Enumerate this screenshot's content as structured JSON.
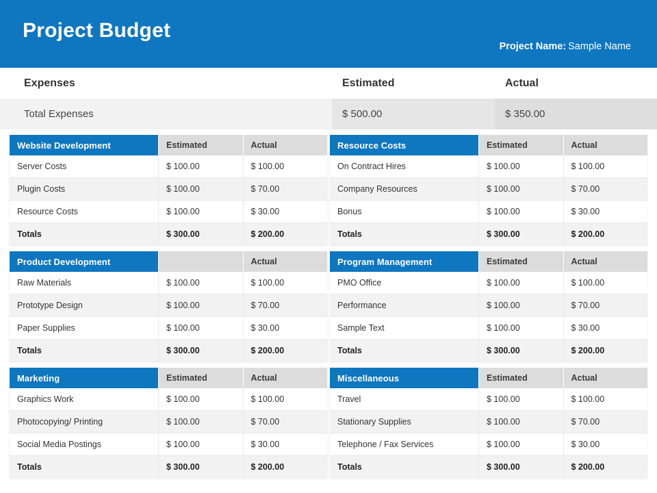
{
  "banner": {
    "title": "Project Budget",
    "project_name_label": "Project Name:",
    "project_name_value": "Sample Name",
    "background_color": "#0f76c0"
  },
  "summary": {
    "headers": {
      "expenses": "Expenses",
      "estimated": "Estimated",
      "actual": "Actual"
    },
    "row": {
      "label": "Total Expenses",
      "estimated": "$ 500.00",
      "actual": "$ 350.00"
    }
  },
  "column_headers": {
    "estimated": "Estimated",
    "actual": "Actual"
  },
  "totals_label": "Totals",
  "accent_color": "#0f76c0",
  "header_cell_color": "#dcdcdc",
  "stripe_color": "#f2f2f2",
  "blocks": [
    {
      "title": "Website Development",
      "estimated_header": "Estimated",
      "actual_header": "Actual",
      "rows": [
        {
          "name": "Server Costs",
          "estimated": "$ 100.00",
          "actual": "$ 100.00"
        },
        {
          "name": " Plugin Costs",
          "estimated": "$ 100.00",
          "actual": "$ 70.00"
        },
        {
          "name": "Resource Costs",
          "estimated": "$ 100.00",
          "actual": "$ 30.00"
        }
      ],
      "totals": {
        "name": "Totals",
        "estimated": "$ 300.00",
        "actual": "$ 200.00"
      }
    },
    {
      "title": "Resource Costs",
      "estimated_header": "Estimated",
      "actual_header": "Actual",
      "rows": [
        {
          "name": "On Contract Hires",
          "estimated": "$ 100.00",
          "actual": "$ 100.00"
        },
        {
          "name": " Company  Resources",
          "estimated": "$ 100.00",
          "actual": "$ 70.00"
        },
        {
          "name": "Bonus",
          "estimated": "$ 100.00",
          "actual": "$ 30.00"
        }
      ],
      "totals": {
        "name": "Totals",
        "estimated": "$ 300.00",
        "actual": "$ 200.00"
      }
    },
    {
      "title": "Product Development",
      "estimated_header": "",
      "actual_header": "Actual",
      "rows": [
        {
          "name": "Raw Materials",
          "estimated": "$ 100.00",
          "actual": "$ 100.00"
        },
        {
          "name": "Prototype Design",
          "estimated": "$ 100.00",
          "actual": "$ 70.00"
        },
        {
          "name": "Paper Supplies",
          "estimated": "$ 100.00",
          "actual": "$ 30.00"
        }
      ],
      "totals": {
        "name": "Totals",
        "estimated": "$ 300.00",
        "actual": "$ 200.00"
      }
    },
    {
      "title": "Program Management",
      "estimated_header": "Estimated",
      "actual_header": "Actual",
      "rows": [
        {
          "name": "PMO Office",
          "estimated": "$ 100.00",
          "actual": "$ 100.00"
        },
        {
          "name": "Performance",
          "estimated": "$ 100.00",
          "actual": "$ 70.00"
        },
        {
          "name": "Sample Text",
          "estimated": "$ 100.00",
          "actual": "$ 30.00"
        }
      ],
      "totals": {
        "name": "Totals",
        "estimated": "$ 300.00",
        "actual": "$ 200.00"
      }
    },
    {
      "title": "Marketing",
      "estimated_header": "Estimated",
      "actual_header": "Actual",
      "rows": [
        {
          "name": "Graphics Work",
          "estimated": "$ 100.00",
          "actual": "$ 100.00"
        },
        {
          "name": "Photocopying/ Printing",
          "estimated": "$ 100.00",
          "actual": "$ 70.00"
        },
        {
          "name": "Social Media Postings",
          "estimated": "$ 100.00",
          "actual": "$ 30.00"
        }
      ],
      "totals": {
        "name": "Totals",
        "estimated": "$ 300.00",
        "actual": "$ 200.00"
      }
    },
    {
      "title": "Miscellaneous",
      "estimated_header": "Estimated",
      "actual_header": "Actual",
      "rows": [
        {
          "name": "Travel",
          "estimated": "$ 100.00",
          "actual": "$ 100.00"
        },
        {
          "name": "Stationary Supplies",
          "estimated": "$ 100.00",
          "actual": "$ 70.00"
        },
        {
          "name": "Telephone / Fax Services",
          "estimated": "$ 100.00",
          "actual": "$ 30.00"
        }
      ],
      "totals": {
        "name": "Totals",
        "estimated": "$ 300.00",
        "actual": "$ 200.00"
      }
    }
  ]
}
